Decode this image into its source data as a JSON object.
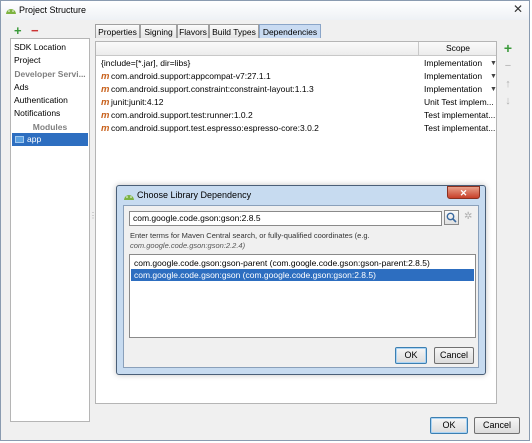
{
  "window": {
    "title": "Project Structure",
    "close_glyph": "✕"
  },
  "left_toolbar": {
    "add_glyph": "+",
    "remove_glyph": "−"
  },
  "left_panel": {
    "items": [
      "SDK Location",
      "Project"
    ],
    "developer_header": "Developer Servi...",
    "developer_items": [
      "Ads",
      "Authentication",
      "Notifications"
    ],
    "modules_header": "Modules",
    "modules": [
      "app"
    ]
  },
  "tabs": [
    "Properties",
    "Signing",
    "Flavors",
    "Build Types",
    "Dependencies"
  ],
  "active_tab": "Dependencies",
  "dependencies": {
    "scope_header": "Scope",
    "rows": [
      {
        "name": "{include=[*.jar], dir=libs}",
        "scope": "Implementation",
        "maven": false
      },
      {
        "name": "com.android.support:appcompat-v7:27.1.1",
        "scope": "Implementation",
        "maven": true
      },
      {
        "name": "com.android.support.constraint:constraint-layout:1.1.3",
        "scope": "Implementation",
        "maven": true
      },
      {
        "name": "junit:junit:4.12",
        "scope": "Unit Test implem...",
        "maven": true
      },
      {
        "name": "com.android.support.test:runner:1.0.2",
        "scope": "Test implementat...",
        "maven": true
      },
      {
        "name": "com.android.support.test.espresso:espresso-core:3.0.2",
        "scope": "Test implementat...",
        "maven": true
      }
    ],
    "maven_icon_glyph": "m",
    "dropdown_glyph": "▼"
  },
  "right_toolbar": {
    "add_glyph": "+",
    "remove_glyph": "−",
    "up_glyph": "↑",
    "down_glyph": "↓"
  },
  "dialog": {
    "title": "Choose Library Dependency",
    "close_glyph": "✕",
    "search_value": "com.google.code.gson:gson:2.8.5",
    "gear_glyph": "✲",
    "hint": "Enter terms for Maven Central search, or fully-qualified coordinates (e.g.",
    "hint_example": "com.google.code.gson:gson:2.2.4)",
    "results": [
      "com.google.code.gson:gson-parent (com.google.code.gson:gson-parent:2.8.5)",
      "com.google.code.gson:gson (com.google.code.gson:gson:2.8.5)"
    ],
    "selected_result_index": 1,
    "ok_label": "OK",
    "cancel_label": "Cancel"
  },
  "footer": {
    "ok_label": "OK",
    "cancel_label": "Cancel"
  },
  "colors": {
    "selection": "#2d6ec0",
    "add_green": "#3a9a3a",
    "remove_red": "#cc3333",
    "maven_orange": "#c8601a"
  }
}
